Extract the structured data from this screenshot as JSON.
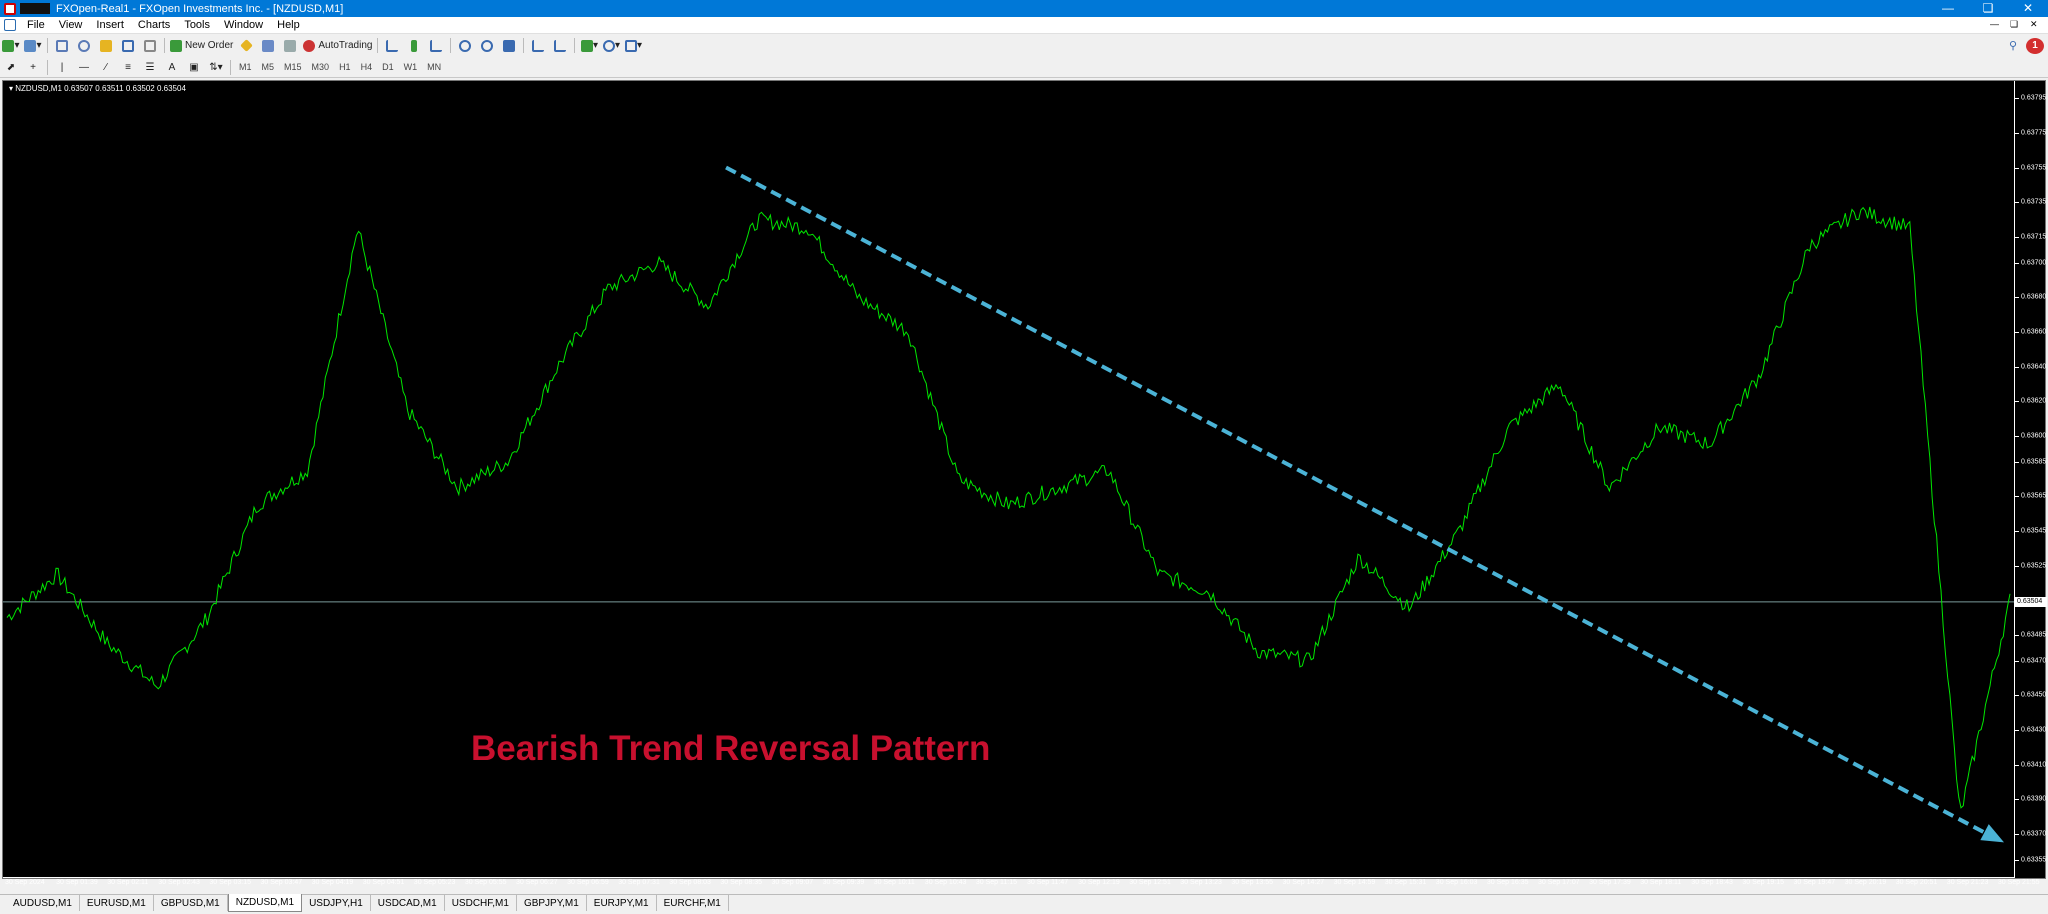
{
  "window": {
    "title": "FXOpen-Real1 - FXOpen Investments Inc. - [NZDUSD,M1]"
  },
  "menu": [
    "File",
    "View",
    "Insert",
    "Charts",
    "Tools",
    "Window",
    "Help"
  ],
  "toolbar": {
    "new_order": "New Order",
    "autotrading": "AutoTrading",
    "notification_count": "1"
  },
  "timeframes": [
    "M1",
    "M5",
    "M15",
    "M30",
    "H1",
    "H4",
    "D1",
    "W1",
    "MN"
  ],
  "chart": {
    "header": "NZDUSD,M1  0.63507 0.63511 0.63502 0.63504",
    "current_price": "0.63504",
    "annotation": "Bearish Trend Reversal Pattern",
    "price_labels": [
      "0.63795",
      "0.63775",
      "0.63755",
      "0.63735",
      "0.63715",
      "0.63700",
      "0.63680",
      "0.63660",
      "0.63640",
      "0.63620",
      "0.63600",
      "0.63585",
      "0.63565",
      "0.63545",
      "0.63525",
      "0.63504",
      "0.63485",
      "0.63470",
      "0.63450",
      "0.63430",
      "0.63410",
      "0.63390",
      "0.63370",
      "0.63355"
    ],
    "time_labels": [
      "30 Sep 2024",
      "30 Sep 01:39",
      "30 Sep 02:11",
      "30 Sep 02:43",
      "30 Sep 03:15",
      "30 Sep 03:47",
      "30 Sep 04:19",
      "30 Sep 04:51",
      "30 Sep 05:23",
      "30 Sep 05:55",
      "30 Sep 06:27",
      "30 Sep 06:59",
      "30 Sep 07:31",
      "30 Sep 08:03",
      "30 Sep 08:35",
      "30 Sep 09:07",
      "30 Sep 09:39",
      "30 Sep 10:11",
      "30 Sep 10:43",
      "30 Sep 11:15",
      "30 Sep 11:47",
      "30 Sep 12:19",
      "30 Sep 12:51",
      "30 Sep 13:23",
      "30 Sep 13:55",
      "30 Sep 14:27",
      "30 Sep 14:59",
      "30 Sep 15:31",
      "30 Sep 16:03",
      "30 Sep 16:35",
      "30 Sep 17:07",
      "30 Sep 17:39",
      "30 Sep 18:11",
      "30 Sep 18:43",
      "30 Sep 19:15",
      "30 Sep 19:47",
      "30 Sep 20:19",
      "30 Sep 20:51",
      "30 Sep 21:23",
      "30 Sep 21:55"
    ],
    "colors": {
      "background": "#000000",
      "line": "#00e600",
      "trendline": "#4bb3d6",
      "annotation": "#c8102e"
    }
  },
  "chart_data": {
    "type": "line",
    "symbol": "NZDUSD",
    "timeframe": "M1",
    "ylim": [
      0.63345,
      0.63805
    ],
    "x": [
      "30 Sep 2024",
      "30 Sep 01:39",
      "30 Sep 02:11",
      "30 Sep 02:43",
      "30 Sep 03:15",
      "30 Sep 03:47",
      "30 Sep 04:19",
      "30 Sep 04:51",
      "30 Sep 05:23",
      "30 Sep 05:55",
      "30 Sep 06:27",
      "30 Sep 06:59",
      "30 Sep 07:31",
      "30 Sep 08:03",
      "30 Sep 08:35",
      "30 Sep 09:07",
      "30 Sep 09:39",
      "30 Sep 10:11",
      "30 Sep 10:43",
      "30 Sep 11:15",
      "30 Sep 11:47",
      "30 Sep 12:19",
      "30 Sep 12:51",
      "30 Sep 13:23",
      "30 Sep 13:55",
      "30 Sep 14:27",
      "30 Sep 14:59",
      "30 Sep 15:31",
      "30 Sep 16:03",
      "30 Sep 16:35",
      "30 Sep 17:07",
      "30 Sep 17:39",
      "30 Sep 18:11",
      "30 Sep 18:43",
      "30 Sep 19:15",
      "30 Sep 19:47",
      "30 Sep 20:19",
      "30 Sep 20:51",
      "30 Sep 21:23",
      "30 Sep 21:55"
    ],
    "series": [
      {
        "values": [
          0.63495,
          0.6352,
          0.6348,
          0.63455,
          0.63495,
          0.6356,
          0.6358,
          0.6372,
          0.63615,
          0.6357,
          0.63585,
          0.6364,
          0.63685,
          0.637,
          0.63675,
          0.63725,
          0.6372,
          0.6368,
          0.6366,
          0.63575,
          0.6356,
          0.6357,
          0.6358,
          0.6352,
          0.6351,
          0.63475,
          0.6347,
          0.6353,
          0.635,
          0.63545,
          0.63605,
          0.6363,
          0.6357,
          0.63605,
          0.63595,
          0.63635,
          0.6371,
          0.6373,
          0.6372,
          0.6338,
          0.63505
        ]
      }
    ],
    "trendline": {
      "start": [
        "30 Sep 08:35",
        0.63755
      ],
      "end": [
        "30 Sep 21:55",
        0.63365
      ],
      "style": "dashed"
    }
  },
  "tabs": [
    "AUDUSD,M1",
    "EURUSD,M1",
    "GBPUSD,M1",
    "NZDUSD,M1",
    "USDJPY,H1",
    "USDCAD,M1",
    "USDCHF,M1",
    "GBPJPY,M1",
    "EURJPY,M1",
    "EURCHF,M1"
  ],
  "active_tab": "NZDUSD,M1"
}
